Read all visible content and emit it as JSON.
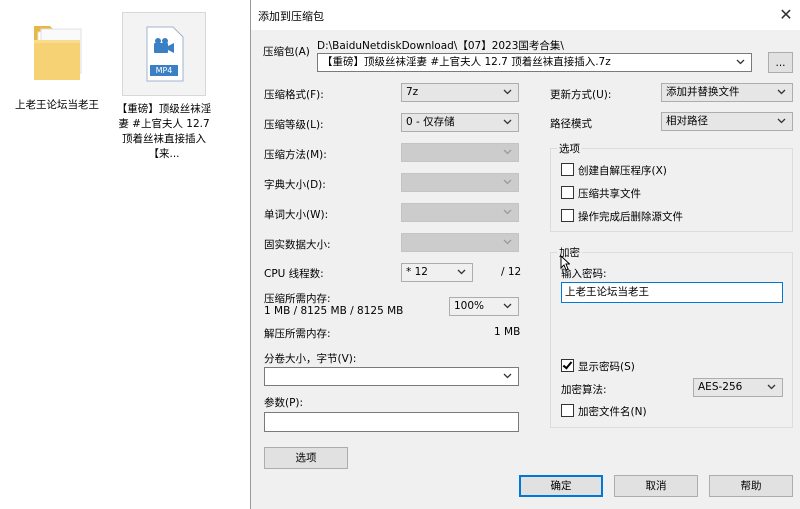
{
  "desktop": {
    "folder": {
      "label": "上老王论坛当老王",
      "icon": "folder-icon"
    },
    "video": {
      "label": "【重磅】顶级丝袜淫妻 #上官夫人 12.7 顶着丝袜直接插入【来...",
      "badge": "MP4",
      "icon": "video-file-icon"
    }
  },
  "dialog": {
    "title": "添加到压缩包",
    "archive_label": "压缩包(A)",
    "archive_path": "D:\\BaiduNetdiskDownload\\【07】2023国考合集\\",
    "archive_name": "【重磅】顶级丝袜淫妻 #上官夫人 12.7 顶着丝袜直接插入.7z",
    "browse_label": "...",
    "format_label": "压缩格式(F):",
    "format_value": "7z",
    "level_label": "压缩等级(L):",
    "level_value": "0 - 仅存储",
    "method_label": "压缩方法(M):",
    "dict_label": "字典大小(D):",
    "word_label": "单词大小(W):",
    "solid_label": "固实数据大小:",
    "cpu_label": "CPU 线程数:",
    "cpu_value": "* 12",
    "cpu_total": "/ 12",
    "mem_comp_label": "压缩所需内存:",
    "mem_comp_value": "1 MB / 8125 MB / 8125 MB",
    "mem_percent": "100%",
    "mem_decomp_label": "解压所需内存:",
    "mem_decomp_value": "1 MB",
    "split_label": "分卷大小，字节(V):",
    "split_value": "",
    "params_label": "参数(P):",
    "params_value": "",
    "options_button": "选项",
    "update_label": "更新方式(U):",
    "update_value": "添加并替换文件",
    "path_mode_label": "路径模式",
    "path_mode_value": "相对路径",
    "options_group": "选项",
    "opt_sfx": "创建自解压程序(X)",
    "opt_shared": "压缩共享文件",
    "opt_delete": "操作完成后删除源文件",
    "encrypt_group": "加密",
    "password_label": "输入密码:",
    "password_value": "上老王论坛当老王",
    "show_password": "显示密码(S)",
    "encrypt_method_label": "加密算法:",
    "encrypt_method_value": "AES-256",
    "encrypt_names": "加密文件名(N)",
    "ok": "确定",
    "cancel": "取消",
    "help": "帮助"
  }
}
